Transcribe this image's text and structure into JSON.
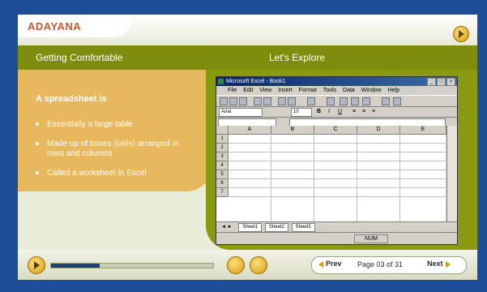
{
  "brand": {
    "logo": "ADAYANA"
  },
  "sections": {
    "left_title": "Getting Comfortable",
    "right_title": "Let's Explore"
  },
  "lesson": {
    "heading": "A spreadsheet is",
    "bullets": [
      "Essentially a large table",
      "Made up of boxes (cells) arranged in rows and columns",
      "Called a worksheet in Excel"
    ]
  },
  "excel": {
    "title": "Microsoft Excel - Book1",
    "menu": [
      "File",
      "Edit",
      "View",
      "Insert",
      "Format",
      "Tools",
      "Data",
      "Window",
      "Help"
    ],
    "font": "Arial",
    "size": "10",
    "columns": [
      "A",
      "B",
      "C",
      "D",
      "E"
    ],
    "rows": [
      "1",
      "2",
      "3",
      "4",
      "5",
      "6",
      "7"
    ],
    "sheets": [
      "Sheet1",
      "Sheet2",
      "Sheet3"
    ],
    "status": "NUM"
  },
  "nav": {
    "prev_label": "Prev",
    "page_info": "Page 03 of 31",
    "next_label": "Next",
    "progress": 0.3
  },
  "colors": {
    "frame": "#1f4e98",
    "olive": "#7f8d0f",
    "panel": "#e8b85e",
    "accent": "#c8572c"
  }
}
